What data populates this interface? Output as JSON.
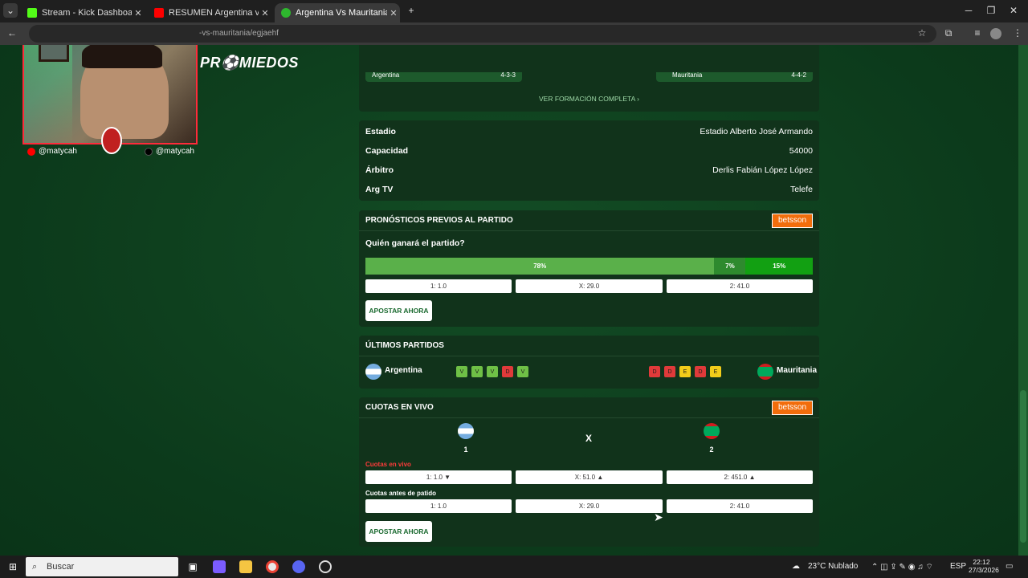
{
  "browser": {
    "tabs": [
      {
        "title": "Stream - Kick Dashboard",
        "icon": "kick-icon",
        "color": "#53fc18"
      },
      {
        "title": "RESUMEN Argentina vs Estado",
        "icon": "youtube-icon",
        "color": "#ff0000"
      },
      {
        "title": "Argentina Vs Mauritania - Resu",
        "icon": "promiedos-icon",
        "color": "#2eb82e"
      }
    ],
    "url": "-vs-mauritania/egjaehf"
  },
  "stream": {
    "handle_left": "@matycah",
    "handle_right": "@matycah",
    "logo_text": "PR⚽MIEDOS"
  },
  "formation": {
    "home_team_short": "Argentina",
    "away_team_short": "Mauritania",
    "home_form": "4-3-3",
    "away_form": "4-4-2",
    "link": "VER FORMACIÓN COMPLETA ›"
  },
  "match_info": [
    {
      "label": "Estadio",
      "value": "Estadio Alberto José Armando"
    },
    {
      "label": "Capacidad",
      "value": "54000"
    },
    {
      "label": "Árbitro",
      "value": "Derlis Fabián López López"
    },
    {
      "label": "Arg TV",
      "value": "Telefe"
    }
  ],
  "predictions": {
    "title": "PRONÓSTICOS PREVIOS AL PARTIDO",
    "sponsor": "betsson",
    "question": "Quién ganará el partido?",
    "bars": [
      {
        "label": "78%",
        "value": 78,
        "color": "#5ab04a"
      },
      {
        "label": "7%",
        "value": 7,
        "color": "#2e8a2e"
      },
      {
        "label": "15%",
        "value": 15,
        "color": "#12a012"
      }
    ],
    "odds": [
      "1: 1.0",
      "X: 29.0",
      "2: 41.0"
    ],
    "cta": "APOSTAR AHORA"
  },
  "last_matches": {
    "title": "ÚLTIMOS PARTIDOS",
    "home": {
      "name": "Argentina",
      "results": [
        "V",
        "V",
        "V",
        "D",
        "V"
      ]
    },
    "away": {
      "name": "Mauritania",
      "results": [
        "D",
        "D",
        "E",
        "D",
        "E"
      ]
    },
    "colors": {
      "V": "#6fc046",
      "D": "#e03a3a",
      "E": "#f2cc1a"
    }
  },
  "live_odds": {
    "title": "CUOTAS EN VIVO",
    "sponsor": "betsson",
    "col_home": "1",
    "col_draw": "X",
    "col_away": "2",
    "live_label": "Cuotas en vivo",
    "live": [
      "1: 1.0 ▼",
      "X: 51.0 ▲",
      "2: 451.0 ▲"
    ],
    "pre_label": "Cuotas antes de patido",
    "pre": [
      "1: 1.0",
      "X: 29.0",
      "2: 41.0"
    ],
    "cta": "APOSTAR AHORA"
  },
  "taskbar": {
    "search": "Buscar",
    "weather": "23°C Nublado",
    "lang": "ESP",
    "time": "22:12",
    "date": "27/3/2026"
  }
}
